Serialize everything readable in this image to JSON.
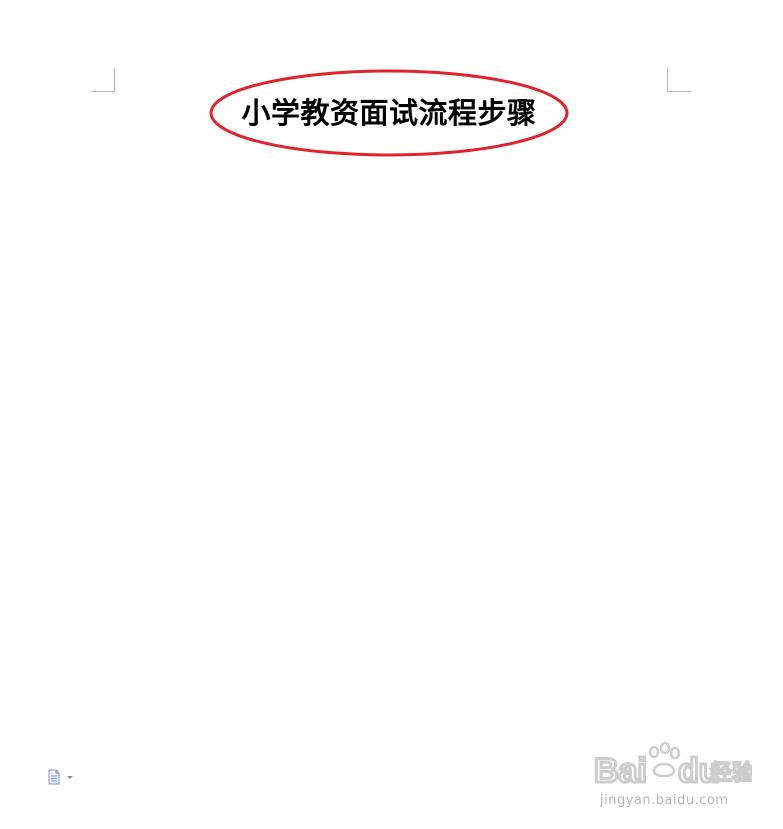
{
  "document": {
    "title": "小学教资面试流程步骤"
  },
  "watermark": {
    "brand_latin_1": "Bai",
    "brand_latin_2": "du",
    "brand_cn": "经验",
    "url": "jingyan.baidu.com"
  },
  "icons": {
    "status_doc": "document-icon",
    "status_dropdown": "chevron-down-icon",
    "watermark_paw": "paw-icon"
  },
  "colors": {
    "annotation_ellipse": "#e0242d",
    "page_background": "#ffffff",
    "margin_marks": "#b8b8b8",
    "watermark": "#c8c8c8"
  }
}
